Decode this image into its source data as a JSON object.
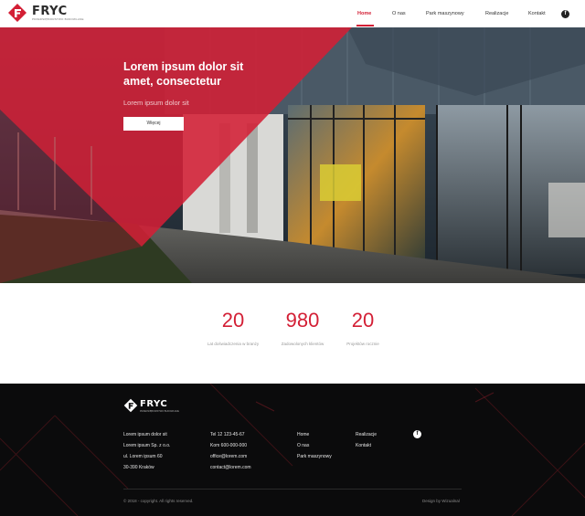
{
  "brand": {
    "name": "FRYC",
    "tagline": "PRZEDSIĘBIORSTWO BUDOWLANE",
    "accent_color": "#d31f35"
  },
  "nav": {
    "items": [
      {
        "label": "Home",
        "active": true
      },
      {
        "label": "O nas",
        "active": false
      },
      {
        "label": "Park maszynowy",
        "active": false
      },
      {
        "label": "Realizacje",
        "active": false
      },
      {
        "label": "Kontakt",
        "active": false
      }
    ],
    "social_icon": "facebook-icon",
    "social_glyph": "f"
  },
  "hero": {
    "title": "Lorem ipsum dolor sit amet, consectetur",
    "subtitle": "Lorem ipsum dolor sit",
    "button_label": "Więcej"
  },
  "stats": [
    {
      "value": "20",
      "label": "Lat doświadczenia w branży"
    },
    {
      "value": "980",
      "label": "Zadowolonych klientów"
    },
    {
      "value": "20",
      "label": "Projektów rocznie"
    }
  ],
  "footer": {
    "address": [
      "Lorem ipsum dolor sit",
      "Lorem ipsum Sp. z o.o.",
      "ul. Lorem ipsum 60",
      "30-390 Kraków"
    ],
    "contact": [
      "Tel 12 123-45-67",
      "Kom 600-000-000",
      "office@lorem.com",
      "contact@lorem.com"
    ],
    "links_col1": [
      "Home",
      "O nas",
      "Park maszynowy"
    ],
    "links_col2": [
      "Realizacje",
      "Kontakt"
    ],
    "copyright": "© 2018 - copyright. All rights reserved.",
    "design_credit": "Design by Wizualnal"
  }
}
